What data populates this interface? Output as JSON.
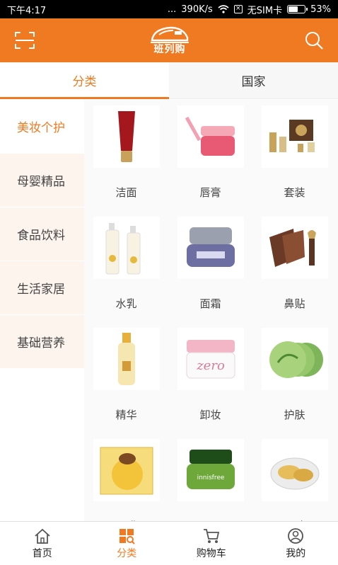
{
  "status_bar": {
    "time": "下午4:17",
    "dots": "...",
    "speed": "390K/s",
    "sim": "无SIM卡",
    "battery": "53%",
    "battery_level": 0.53
  },
  "header": {
    "logo_text": "班列购",
    "accent_color": "#ef7a22"
  },
  "tabs": [
    {
      "label": "分类",
      "active": true
    },
    {
      "label": "国家",
      "active": false
    }
  ],
  "sidebar": {
    "items": [
      {
        "label": "美妆个护",
        "active": true
      },
      {
        "label": "母婴精品"
      },
      {
        "label": "食品饮料"
      },
      {
        "label": "生活家居"
      },
      {
        "label": "基础营养"
      }
    ]
  },
  "products": [
    {
      "label": "洁面",
      "icon": "cleanser-tube"
    },
    {
      "label": "唇膏",
      "icon": "lip-mask-jar"
    },
    {
      "label": "套装",
      "icon": "gift-set"
    },
    {
      "label": "水乳",
      "icon": "lotion-bottles"
    },
    {
      "label": "面霜",
      "icon": "cream-jar"
    },
    {
      "label": "鼻贴",
      "icon": "nose-strips"
    },
    {
      "label": "精华",
      "icon": "serum-bottle"
    },
    {
      "label": "卸妆",
      "icon": "cleansing-balm"
    },
    {
      "label": "护肤",
      "icon": "aloe-pads"
    },
    {
      "label": "面膜",
      "icon": "face-mask-pack"
    },
    {
      "label": "眼霜",
      "icon": "eye-cream-jar"
    },
    {
      "label": "眼贴",
      "icon": "eye-patch-jar"
    }
  ],
  "bottom_nav": [
    {
      "label": "首页",
      "icon": "home-icon"
    },
    {
      "label": "分类",
      "icon": "category-icon",
      "active": true
    },
    {
      "label": "购物车",
      "icon": "cart-icon"
    },
    {
      "label": "我的",
      "icon": "profile-icon"
    }
  ]
}
